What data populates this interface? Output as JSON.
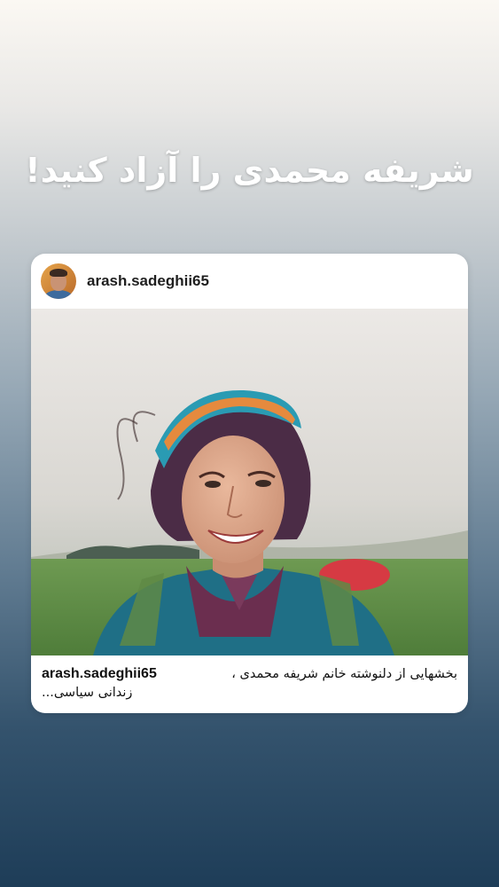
{
  "headline": "شریفه محمدی را آزاد کنید!",
  "post": {
    "username": "arash.sadeghii65",
    "avatar": "user-avatar",
    "photo": "woman-smiling-headband-photo",
    "caption": {
      "username": "arash.sadeghii65",
      "text_line1": "بخشهایی از دلنوشته خانم شریفه محمدی ،",
      "text_line2": "زندانی سیاسی..."
    }
  }
}
